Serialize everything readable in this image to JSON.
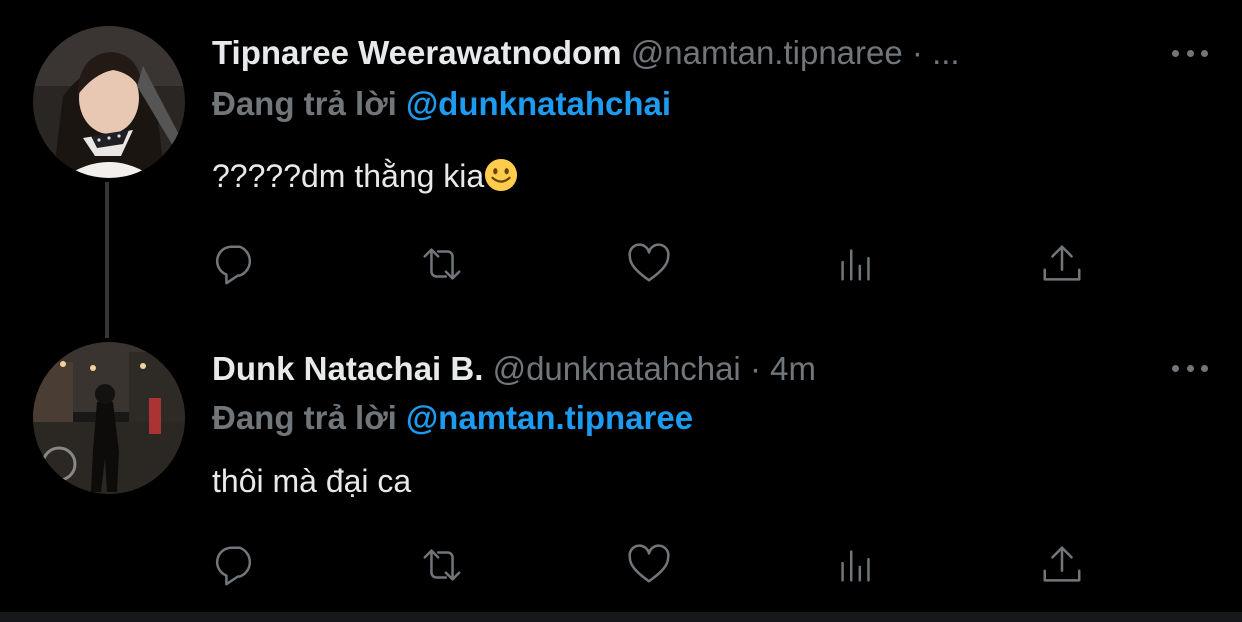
{
  "colors": {
    "background": "#000000",
    "text_primary": "#e7e9ea",
    "text_secondary": "#71767b",
    "link": "#1d9bf0"
  },
  "tweets": [
    {
      "display_name": "Tipnaree Weerawatnodom",
      "handle": "@namtan.tipnaree",
      "meta": "· ...",
      "reply_prefix": "Đang trả lời",
      "reply_to": "@dunknatahchai",
      "text": "?????dm thằng kia",
      "emoji": "slightly-smiling-face-emoji",
      "actions": [
        "reply-icon",
        "retweet-icon",
        "like-icon",
        "analytics-icon",
        "share-icon"
      ]
    },
    {
      "display_name": "Dunk Natachai B.",
      "handle": "@dunknatahchai",
      "meta": "· 4m",
      "reply_prefix": "Đang trả lời",
      "reply_to": "@namtan.tipnaree",
      "text": "thôi mà đại ca",
      "actions": [
        "reply-icon",
        "retweet-icon",
        "like-icon",
        "analytics-icon",
        "share-icon"
      ]
    }
  ]
}
